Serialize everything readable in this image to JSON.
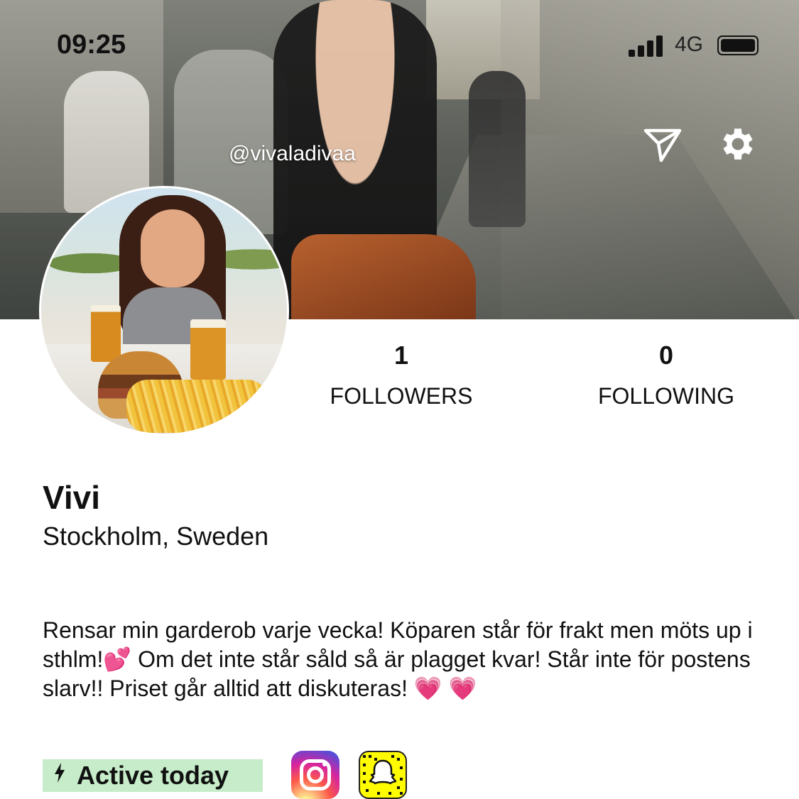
{
  "status_bar": {
    "time": "09:25",
    "network": "4G"
  },
  "profile": {
    "username": "@vivaladivaa",
    "name": "Vivi",
    "location": "Stockholm, Sweden",
    "bio": "Rensar min garderob varje vecka! Köparen står för frakt men möts up i sthlm!💕 Om det inte står såld så är plagget kvar! Står inte för postens slarv!! Priset går alltid att diskuteras! 💗 💗",
    "activity": "Active today"
  },
  "stats": {
    "followers_count": "1",
    "followers_label": "FOLLOWERS",
    "following_count": "0",
    "following_label": "FOLLOWING"
  },
  "icons": {
    "send": "send-icon",
    "settings": "gear-icon",
    "instagram": "instagram-icon",
    "snapchat": "snapchat-icon",
    "activity": "lightning-icon"
  },
  "colors": {
    "active_badge": "#c6ecc9",
    "snapchat": "#fffc00"
  }
}
